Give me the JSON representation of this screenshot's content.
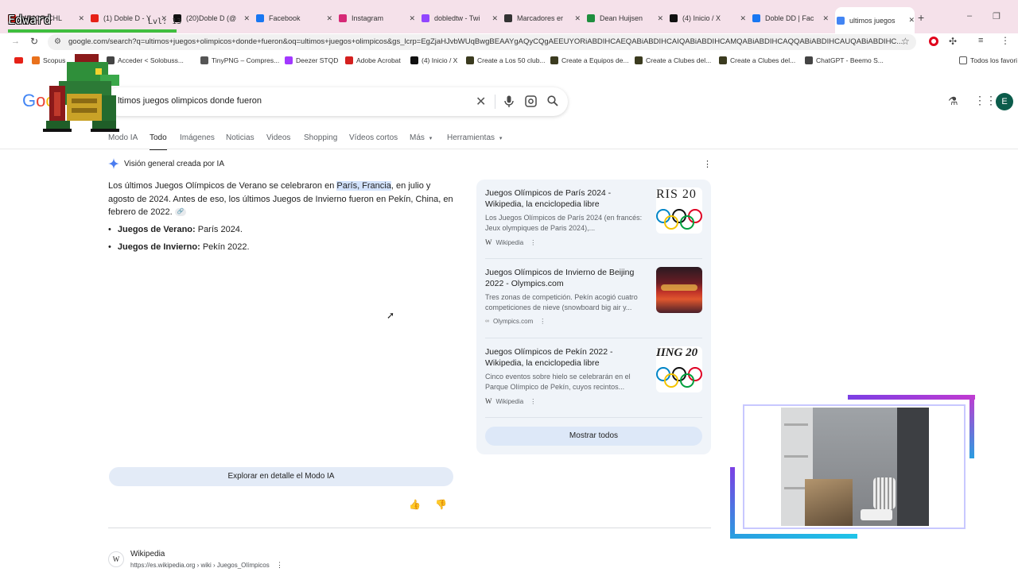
{
  "browser": {
    "tabs": [
      {
        "title": "MEJOR CHL",
        "icon": "youtube-icon",
        "color": "#e62117"
      },
      {
        "title": "(1) Doble D - Y",
        "icon": "youtube-icon",
        "color": "#e62117"
      },
      {
        "title": "(20)Doble D (@",
        "icon": "tiktok-icon",
        "color": "#111111"
      },
      {
        "title": "Facebook",
        "icon": "facebook-icon",
        "color": "#1877f2"
      },
      {
        "title": "Instagram",
        "icon": "instagram-icon",
        "color": "#d62976"
      },
      {
        "title": "dobledtw - Twi",
        "icon": "twitch-icon",
        "color": "#9146ff"
      },
      {
        "title": "Marcadores er",
        "icon": "bookmark-app-icon",
        "color": "#333333"
      },
      {
        "title": "Dean Huijsen",
        "icon": "sheets-icon",
        "color": "#1e8e3e"
      },
      {
        "title": "(4) Inicio / X",
        "icon": "x-icon",
        "color": "#111111"
      },
      {
        "title": "Doble DD | Fac",
        "icon": "facebook-icon",
        "color": "#1877f2"
      },
      {
        "title": "ultimos juegos",
        "icon": "google-icon",
        "color": "#4285f4"
      }
    ],
    "url": "google.com/search?q=ultimos+juegos+olimpicos+donde+fueron&oq=ultimos+juegos+olimpicos&gs_lcrp=EgZjaHJvbWUqBwgBEAAYgAQyCQgAEEUYORiABDIHCAEQABiABDIHCAIQABiABDIHCAMQABiABDIHCAQQABiABDIHCAUQABiABDIHC...",
    "bookmarks": [
      {
        "label": "Scopus",
        "icon": "scopus-icon",
        "color": "#e9711c"
      },
      {
        "label": "Acceder < Solobuss...",
        "icon": "page-icon",
        "color": "#444444"
      },
      {
        "label": "TinyPNG – Compres...",
        "icon": "panda-icon",
        "color": "#555555"
      },
      {
        "label": "Deezer STQD",
        "icon": "heart-icon",
        "color": "#a238ff"
      },
      {
        "label": "Adobe Acrobat",
        "icon": "acrobat-icon",
        "color": "#d4201f"
      },
      {
        "label": "(4) Inicio / X",
        "icon": "x-icon",
        "color": "#111111"
      },
      {
        "label": "Create a Los 50 club...",
        "icon": "page-icon",
        "color": "#3b3b1f"
      },
      {
        "label": "Create a Equipos de...",
        "icon": "page-icon",
        "color": "#3b3b1f"
      },
      {
        "label": "Create a Clubes del...",
        "icon": "page-icon",
        "color": "#3b3b1f"
      },
      {
        "label": "Create a Clubes del...",
        "icon": "page-icon",
        "color": "#3b3b1f"
      },
      {
        "label": "ChatGPT - Beemo S...",
        "icon": "chatgpt-icon",
        "color": "#444444"
      }
    ],
    "bookmarks_folder": "Todos los favori"
  },
  "search": {
    "query": "ltimos juegos olimpicos donde fueron",
    "tabs": [
      "Modo IA",
      "Todo",
      "Imágenes",
      "Noticias",
      "Videos",
      "Shopping",
      "Vídeos cortos",
      "Más",
      "Herramientas"
    ],
    "account_initial": "E"
  },
  "ai_overview": {
    "heading": "Visión general creada por IA",
    "text_before": "Los últimos Juegos Olímpicos de Verano se celebraron en ",
    "highlight": "París, Francia",
    "text_after": ", en julio y agosto de 2024. Antes de eso, los últimos Juegos de Invierno fueron en Pekín, China, en febrero de 2022.",
    "bullets": [
      {
        "bold": "Juegos de Verano:",
        "text": " París 2024."
      },
      {
        "bold": "Juegos de Invierno:",
        "text": " Pekín 2022."
      }
    ],
    "sources": [
      {
        "title": "Juegos Olímpicos de París 2024 - Wikipedia, la enciclopedia libre",
        "snippet": "Los Juegos Olímpicos de París 2024 (en francés: Jeux olympiques de Paris 2024),...",
        "site": "Wikipedia",
        "thumb_text": "RIS 20"
      },
      {
        "title": "Juegos Olímpicos de Invierno de Beijing 2022 - Olympics.com",
        "snippet": "Tres zonas de competición. Pekín acogió cuatro competiciones de nieve (snowboard big air y...",
        "site": "Olympics.com",
        "thumb_text": ""
      },
      {
        "title": "Juegos Olímpicos de Pekín 2022 - Wikipedia, la enciclopedia libre",
        "snippet": "Cinco eventos sobre hielo se celebrarán en el Parque Olímpico de Pekín, cuyos recintos...",
        "site": "Wikipedia",
        "thumb_text": "IING 20"
      }
    ],
    "show_all": "Mostrar todos",
    "explore": "Explorar en detalle el Modo IA"
  },
  "result": {
    "site": "Wikipedia",
    "url": "https://es.wikipedia.org › wiki › Juegos_Olímpicos"
  },
  "overlay": {
    "streamer": "Edward",
    "level": "Lvl: 13"
  }
}
